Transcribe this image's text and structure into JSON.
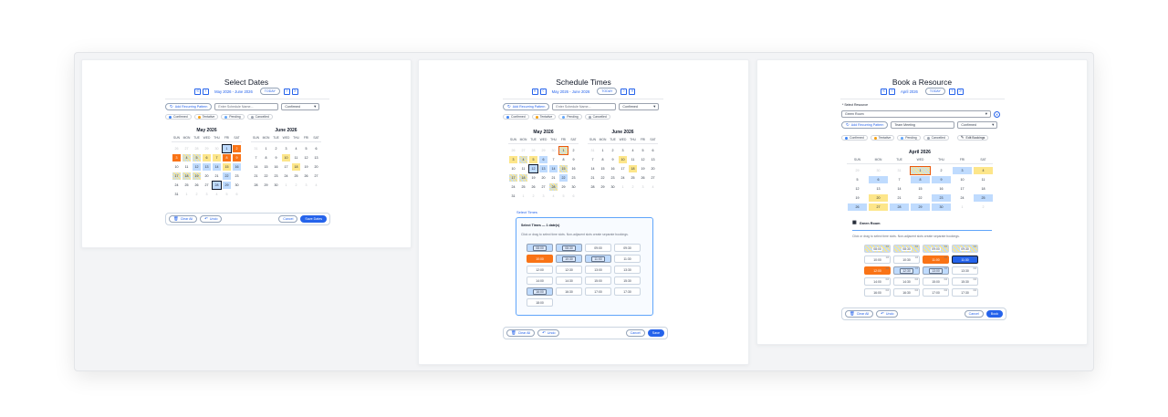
{
  "panel1": {
    "title": "Select Dates",
    "range": "May 2026 - June 2026",
    "today": "TODAY",
    "add_recurring": "Add Recurring Pattern",
    "name_placeholder": "Enter Schedule Name...",
    "status_value": "Confirmed",
    "legend": [
      "Confirmed",
      "Tentative",
      "Pending",
      "Cancelled"
    ],
    "weekdays": [
      "SUN",
      "MON",
      "TUE",
      "WED",
      "THU",
      "FRI",
      "SAT"
    ],
    "months": [
      {
        "name": "May 2026",
        "days": [
          [
            "26",
            "m"
          ],
          [
            "27",
            "m"
          ],
          [
            "28",
            "m"
          ],
          [
            "29",
            "m"
          ],
          [
            "30",
            "m"
          ],
          [
            "1",
            "o"
          ],
          [
            "2",
            "s"
          ],
          [
            "3",
            "s"
          ],
          [
            "4",
            "h"
          ],
          [
            "5",
            "h"
          ],
          [
            "6",
            "t"
          ],
          [
            "7",
            "t"
          ],
          [
            "8",
            "s"
          ],
          [
            "9",
            "s"
          ],
          [
            "10",
            ""
          ],
          [
            "11",
            ""
          ],
          [
            "12",
            "c"
          ],
          [
            "13",
            "c"
          ],
          [
            "14",
            "c"
          ],
          [
            "15",
            "t"
          ],
          [
            "16",
            "c"
          ],
          [
            "17",
            "h"
          ],
          [
            "18",
            "h"
          ],
          [
            "19",
            "h"
          ],
          [
            "20",
            ""
          ],
          [
            "21",
            ""
          ],
          [
            "22",
            "c"
          ],
          [
            "23",
            ""
          ],
          [
            "24",
            ""
          ],
          [
            "25",
            ""
          ],
          [
            "26",
            ""
          ],
          [
            "27",
            ""
          ],
          [
            "28",
            "o"
          ],
          [
            "29",
            "c"
          ],
          [
            "30",
            ""
          ],
          [
            "31",
            ""
          ],
          [
            "1",
            "m"
          ],
          [
            "2",
            "m"
          ],
          [
            "3",
            "m"
          ],
          [
            "4",
            "m"
          ],
          [
            "5",
            "m"
          ],
          [
            "6",
            "m"
          ]
        ]
      },
      {
        "name": "June 2026",
        "days": [
          [
            "31",
            "m"
          ],
          [
            "1",
            ""
          ],
          [
            "2",
            ""
          ],
          [
            "3",
            ""
          ],
          [
            "4",
            ""
          ],
          [
            "5",
            ""
          ],
          [
            "6",
            ""
          ],
          [
            "7",
            ""
          ],
          [
            "8",
            ""
          ],
          [
            "9",
            ""
          ],
          [
            "10",
            "t"
          ],
          [
            "11",
            ""
          ],
          [
            "12",
            ""
          ],
          [
            "13",
            ""
          ],
          [
            "14",
            ""
          ],
          [
            "15",
            ""
          ],
          [
            "16",
            ""
          ],
          [
            "17",
            ""
          ],
          [
            "18",
            "t"
          ],
          [
            "19",
            ""
          ],
          [
            "20",
            ""
          ],
          [
            "21",
            ""
          ],
          [
            "22",
            ""
          ],
          [
            "23",
            ""
          ],
          [
            "24",
            ""
          ],
          [
            "25",
            ""
          ],
          [
            "26",
            ""
          ],
          [
            "27",
            ""
          ],
          [
            "28",
            ""
          ],
          [
            "29",
            ""
          ],
          [
            "30",
            ""
          ],
          [
            "1",
            "m"
          ],
          [
            "2",
            "m"
          ],
          [
            "3",
            "m"
          ],
          [
            "4",
            "m"
          ]
        ]
      }
    ],
    "clear_all": "Clear All",
    "undo": "Undo",
    "cancel": "Cancel",
    "save": "Save Dates"
  },
  "panel2": {
    "title": "Schedule Times",
    "range": "May 2026 - June 2026",
    "today": "TODAY",
    "add_recurring": "Add Recurring Pattern",
    "name_placeholder": "Enter Schedule Name...",
    "status_value": "Confirmed",
    "legend": [
      "Confirmed",
      "Tentative",
      "Pending",
      "Cancelled"
    ],
    "weekdays": [
      "SUN",
      "MON",
      "TUE",
      "WED",
      "THU",
      "FRI",
      "SAT"
    ],
    "months": [
      {
        "name": "May 2026",
        "days": [
          [
            "26",
            "m"
          ],
          [
            "27",
            "m"
          ],
          [
            "28",
            "m"
          ],
          [
            "29",
            "m"
          ],
          [
            "30",
            "m"
          ],
          [
            "1",
            "os"
          ],
          [
            "2",
            ""
          ],
          [
            "3",
            "t"
          ],
          [
            "4",
            "h"
          ],
          [
            "5",
            "t"
          ],
          [
            "6",
            "c"
          ],
          [
            "7",
            ""
          ],
          [
            "8",
            ""
          ],
          [
            "9",
            ""
          ],
          [
            "10",
            ""
          ],
          [
            "11",
            ""
          ],
          [
            "12",
            "o"
          ],
          [
            "13",
            "c"
          ],
          [
            "14",
            "c"
          ],
          [
            "15",
            "h"
          ],
          [
            "16",
            ""
          ],
          [
            "17",
            "h"
          ],
          [
            "18",
            "h"
          ],
          [
            "19",
            ""
          ],
          [
            "20",
            ""
          ],
          [
            "21",
            ""
          ],
          [
            "22",
            "c"
          ],
          [
            "23",
            ""
          ],
          [
            "24",
            ""
          ],
          [
            "25",
            ""
          ],
          [
            "26",
            ""
          ],
          [
            "27",
            ""
          ],
          [
            "28",
            "h"
          ],
          [
            "29",
            ""
          ],
          [
            "30",
            ""
          ],
          [
            "31",
            ""
          ],
          [
            "1",
            "m"
          ],
          [
            "2",
            "m"
          ],
          [
            "3",
            "m"
          ],
          [
            "4",
            "m"
          ],
          [
            "5",
            "m"
          ],
          [
            "6",
            "m"
          ]
        ]
      },
      {
        "name": "June 2026",
        "days": [
          [
            "31",
            "m"
          ],
          [
            "1",
            ""
          ],
          [
            "2",
            ""
          ],
          [
            "3",
            ""
          ],
          [
            "4",
            ""
          ],
          [
            "5",
            ""
          ],
          [
            "6",
            ""
          ],
          [
            "7",
            ""
          ],
          [
            "8",
            ""
          ],
          [
            "9",
            ""
          ],
          [
            "10",
            "t"
          ],
          [
            "11",
            ""
          ],
          [
            "12",
            ""
          ],
          [
            "13",
            ""
          ],
          [
            "14",
            ""
          ],
          [
            "15",
            ""
          ],
          [
            "16",
            ""
          ],
          [
            "17",
            ""
          ],
          [
            "18",
            "t"
          ],
          [
            "19",
            ""
          ],
          [
            "20",
            ""
          ],
          [
            "21",
            ""
          ],
          [
            "22",
            ""
          ],
          [
            "23",
            ""
          ],
          [
            "24",
            ""
          ],
          [
            "25",
            ""
          ],
          [
            "26",
            ""
          ],
          [
            "27",
            ""
          ],
          [
            "28",
            ""
          ],
          [
            "29",
            ""
          ],
          [
            "30",
            ""
          ],
          [
            "1",
            "m"
          ],
          [
            "2",
            "m"
          ],
          [
            "3",
            "m"
          ],
          [
            "4",
            "m"
          ]
        ]
      }
    ],
    "select_times_label": "Select Times",
    "times_header": "Select Times — 1 date(s)",
    "times_hint": "Click or drag to select time slots. Non-adjacent slots create separate bookings.",
    "slots": [
      [
        "08:00",
        "c"
      ],
      [
        "08:30",
        "c"
      ],
      [
        "09:00",
        ""
      ],
      [
        "09:30",
        ""
      ],
      [
        "10:00",
        "s"
      ],
      [
        "10:30",
        "c"
      ],
      [
        "11:00",
        "c"
      ],
      [
        "11:30",
        ""
      ],
      [
        "12:00",
        ""
      ],
      [
        "12:30",
        ""
      ],
      [
        "13:00",
        ""
      ],
      [
        "13:30",
        ""
      ],
      [
        "14:00",
        ""
      ],
      [
        "14:30",
        ""
      ],
      [
        "15:00",
        ""
      ],
      [
        "15:30",
        ""
      ],
      [
        "16:00",
        "c"
      ],
      [
        "16:30",
        ""
      ],
      [
        "17:00",
        ""
      ],
      [
        "17:30",
        ""
      ],
      [
        "18:00",
        ""
      ]
    ],
    "clear_all": "Clear All",
    "undo": "Undo",
    "cancel": "Cancel",
    "save": "Save"
  },
  "panel3": {
    "title": "Book a Resource",
    "range": "April 2026",
    "today": "TODAY",
    "select_resource_label": "* Select Resource",
    "resource_value": "Green Room",
    "add_recurring": "Add Recurring Pattern",
    "meeting_placeholder": "Team Meeting",
    "status_value": "Confirmed",
    "legend": [
      "Confirmed",
      "Tentative",
      "Pending",
      "Cancelled"
    ],
    "edit_bookings": "Edit Bookings",
    "weekdays": [
      "SUN",
      "MON",
      "TUE",
      "WED",
      "THU",
      "FRI",
      "SAT"
    ],
    "month": {
      "name": "April 2026",
      "days": [
        [
          "29",
          "m"
        ],
        [
          "30",
          "m"
        ],
        [
          "31",
          "m"
        ],
        [
          "1",
          "os"
        ],
        [
          "2",
          ""
        ],
        [
          "3",
          "c"
        ],
        [
          "4",
          "t"
        ],
        [
          "5",
          ""
        ],
        [
          "6",
          "c"
        ],
        [
          "7",
          ""
        ],
        [
          "8",
          "c"
        ],
        [
          "9",
          "c"
        ],
        [
          "10",
          ""
        ],
        [
          "11",
          ""
        ],
        [
          "12",
          ""
        ],
        [
          "13",
          ""
        ],
        [
          "14",
          ""
        ],
        [
          "15",
          ""
        ],
        [
          "16",
          ""
        ],
        [
          "17",
          ""
        ],
        [
          "18",
          ""
        ],
        [
          "19",
          ""
        ],
        [
          "20",
          "t"
        ],
        [
          "21",
          ""
        ],
        [
          "22",
          ""
        ],
        [
          "23",
          "c"
        ],
        [
          "24",
          ""
        ],
        [
          "25",
          "c"
        ],
        [
          "26",
          "c"
        ],
        [
          "27",
          "t"
        ],
        [
          "28",
          "c"
        ],
        [
          "29",
          "c"
        ],
        [
          "30",
          "c"
        ],
        [
          "1",
          "m"
        ],
        [
          "2",
          "m"
        ]
      ]
    },
    "room_name": "Green Room",
    "times_hint": "Click or drag to select time slots. Non-adjacent slots create separate bookings.",
    "slots": [
      [
        "08:00",
        "h",
        "3/4"
      ],
      [
        "08:30",
        "h",
        "3/4"
      ],
      [
        "09:00",
        "h",
        "3/4"
      ],
      [
        "09:30",
        "h",
        "2/4"
      ],
      [
        "10:00",
        "",
        "1/4"
      ],
      [
        "10:30",
        "",
        "1/4"
      ],
      [
        "11:00",
        "s",
        "2/4"
      ],
      [
        "11:30",
        "d",
        "4/4"
      ],
      [
        "12:00",
        "s",
        "2/4"
      ],
      [
        "12:30",
        "c",
        "1/4"
      ],
      [
        "13:00",
        "c",
        "1/4"
      ],
      [
        "13:30",
        "",
        "0/4"
      ],
      [
        "14:00",
        "",
        "0/4"
      ],
      [
        "14:30",
        "",
        "0/4"
      ],
      [
        "15:00",
        "",
        "0/4"
      ],
      [
        "15:30",
        "",
        "0/4"
      ],
      [
        "16:00",
        "",
        "0/4"
      ],
      [
        "16:30",
        "",
        "0/4"
      ],
      [
        "17:00",
        "",
        "0/4"
      ],
      [
        "17:30",
        "",
        "0/4"
      ]
    ],
    "clear_all": "Clear All",
    "undo": "Undo",
    "cancel": "Cancel",
    "save": "Book"
  },
  "colors": {
    "accent": "#2563eb",
    "confirmed": "#bfdbfe",
    "tentative": "#fde68a",
    "selected": "#f97316",
    "legend_confirmed": "#3b82f6",
    "legend_tentative": "#f59e0b",
    "legend_pending": "#60a5fa",
    "legend_cancelled": "#9ca3af"
  }
}
